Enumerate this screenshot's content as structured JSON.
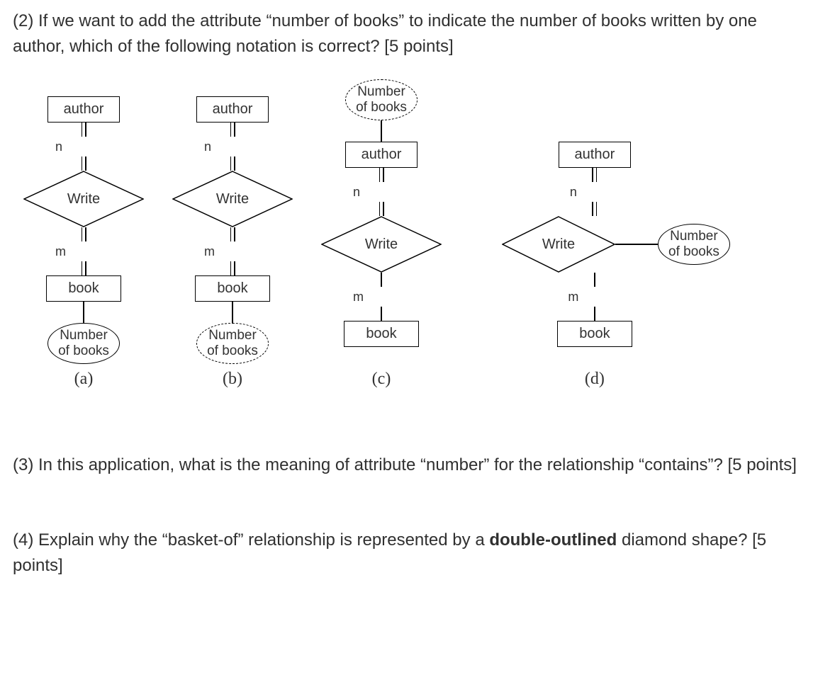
{
  "q2": {
    "text": "(2) If we want to add the attribute “number of books” to indicate the number of books written by one author, which of the following notation is correct? [5 points]"
  },
  "labels": {
    "author": "author",
    "book": "book",
    "write": "Write",
    "nob_l1": "Number",
    "nob_l2": "of books",
    "n": "n",
    "m": "m"
  },
  "options": {
    "a": "(a)",
    "b": "(b)",
    "c": "(c)",
    "d": "(d)"
  },
  "q3": {
    "text": "(3) In this application, what is the meaning of attribute “number” for the relationship “contains”? [5 points]"
  },
  "q4": {
    "prefix": "(4) Explain why the “basket-of” relationship is represented by a ",
    "bold": "double-outlined",
    "suffix": " diamond shape? [5 points]"
  }
}
